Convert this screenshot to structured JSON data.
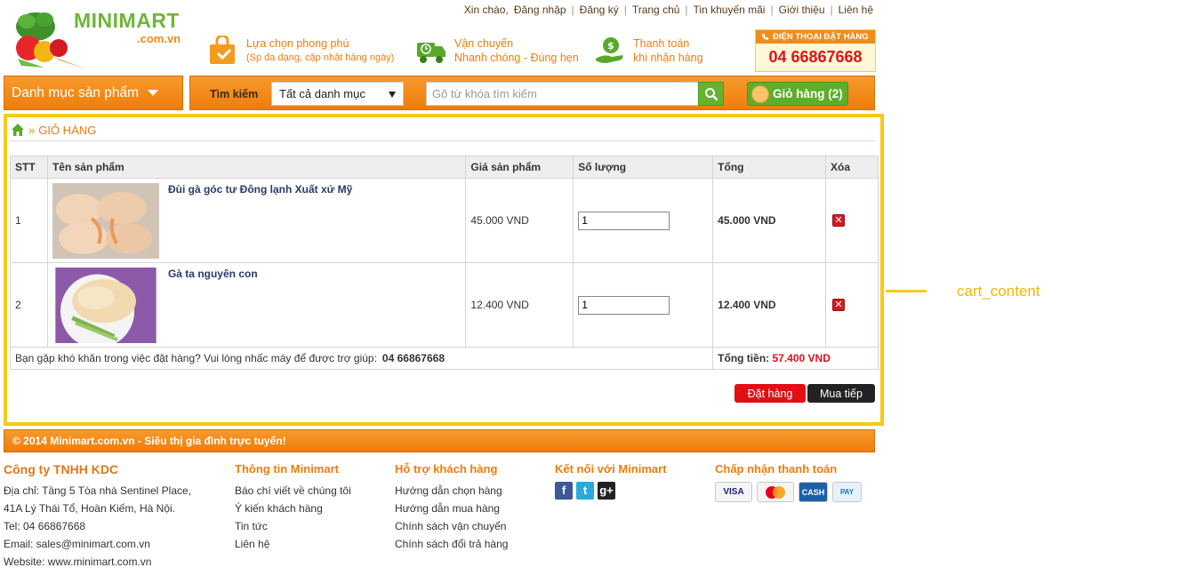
{
  "logo": {
    "name": "MINIMART",
    "domain": ".com.vn"
  },
  "toplinks": {
    "greeting": "Xin chào,",
    "items": [
      "Đăng nhập",
      "Đăng ký",
      "Trang chủ",
      "Tin khuyến mãi",
      "Giới thiệu",
      "Liên hệ"
    ]
  },
  "features": [
    {
      "icon": "shopping-bag-icon",
      "line1": "Lựa chọn phong phú",
      "line2": "(Sp đa dạng, cập nhật hàng ngày)"
    },
    {
      "icon": "delivery-truck-icon",
      "line1": "Vận chuyển",
      "line2": "Nhanh chóng - Đúng hẹn"
    },
    {
      "icon": "cash-hand-icon",
      "line1": "Thanh toán",
      "line2": "khi nhận hàng"
    }
  ],
  "hotline": {
    "title": "ĐIỆN THOẠI ĐẶT HÀNG",
    "number": "04 66867668"
  },
  "nav": {
    "category_button": "Danh mục sản phẩm",
    "search_label": "Tìm kiếm",
    "search_scope": "Tất cả danh mục",
    "search_placeholder": "Gõ từ khóa tìm kiếm",
    "cart_label": "Giỏ hàng (2)"
  },
  "breadcrumb": {
    "separator": "»",
    "current": "GIỎ HÀNG"
  },
  "cart": {
    "headers": [
      "STT",
      "Tên sản phẩm",
      "Giá sản phẩm",
      "Số lượng",
      "Tổng",
      "Xóa"
    ],
    "rows": [
      {
        "stt": "1",
        "name": "Đùi gà góc tư Đông lạnh Xuất xứ Mỹ",
        "price": "45.000 VND",
        "qty": "1",
        "total": "45.000 VND"
      },
      {
        "stt": "2",
        "name": "Gà ta nguyên con",
        "price": "12.400 VND",
        "qty": "1",
        "total": "12.400 VND"
      }
    ],
    "help_text": "Bạn gặp khó khăn trong việc đặt hàng? Vui lòng nhấc máy để được trợ giúp:",
    "help_number": "04 66867668",
    "grand_label": "Tổng tiền:",
    "grand_value": "57.400 VND",
    "order_button": "Đặt hàng",
    "continue_button": "Mua tiếp"
  },
  "annotation": {
    "label": "cart_content",
    "color": "#f7c918"
  },
  "footer": {
    "copyright": "© 2014 Minimart.com.vn - Siêu thị gia đình trực tuyến!",
    "company": {
      "title": "Công ty TNHH KDC",
      "lines": [
        "Địa chỉ: Tầng 5 Tòa nhà Sentinel Place,",
        "41A Lý Thái Tổ, Hoàn Kiếm, Hà Nội.",
        "Tel: 04 66867668",
        "Email: sales@minimart.com.vn",
        "Website: www.minimart.com.vn"
      ]
    },
    "info": {
      "title": "Thông tin Minimart",
      "links": [
        "Báo chí viết về chúng tôi",
        "Ý kiến khách hàng",
        "Tin tức",
        "Liên hệ"
      ]
    },
    "support": {
      "title": "Hỗ trợ khách hàng",
      "links": [
        "Hướng dẫn chọn hàng",
        "Hướng dẫn mua hàng",
        "Chính sách vận chuyển",
        "Chính sách đổi trả hàng"
      ]
    },
    "connect": {
      "title": "Kết nối với Minimart",
      "icons": [
        "facebook-icon",
        "twitter-icon",
        "google-plus-icon"
      ]
    },
    "payment": {
      "title": "Chấp nhận thanh toán",
      "methods": [
        "VISA",
        "MasterCard",
        "CASH",
        "OnePAY"
      ]
    }
  },
  "colors": {
    "brand_orange": "#ee7d0c",
    "brand_green": "#6fb53a",
    "price_red": "#e2101a",
    "highlight_yellow": "#f7c918"
  }
}
